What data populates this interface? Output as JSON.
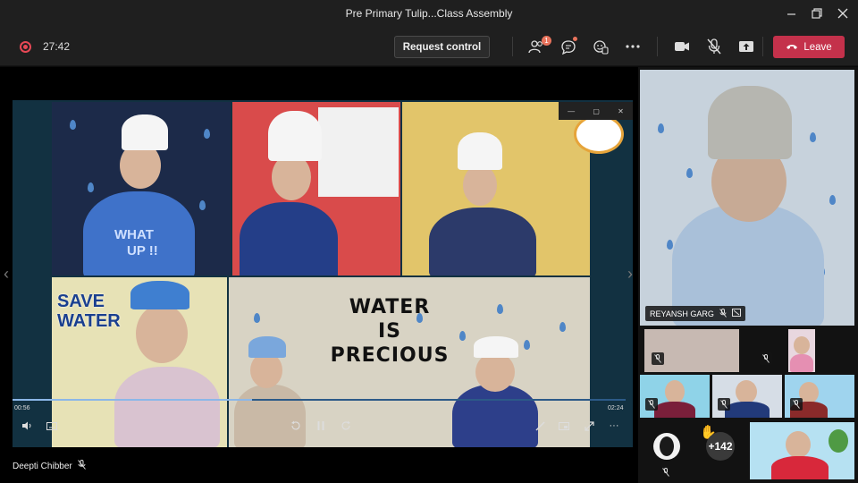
{
  "window": {
    "title": "Pre Primary Tulip...Class Assembly",
    "minimize_icon": "minimize-icon",
    "restore_icon": "restore-icon",
    "close_icon": "close-icon"
  },
  "toolbar": {
    "meeting_timer": "27:42",
    "request_control_label": "Request control",
    "participants_badge": "1",
    "leave_label": "Leave",
    "icons": [
      "record-icon",
      "participants-icon",
      "chat-icon",
      "reactions-icon",
      "more-icon",
      "camera-icon",
      "mic-off-icon",
      "share-icon",
      "phone-icon"
    ]
  },
  "shared_content": {
    "slogan_lines": [
      "WATER",
      "IS",
      "PRECIOUS"
    ],
    "save_water_lines": [
      "SAVE",
      "WATER"
    ],
    "shirt_text_lines": [
      "WHAT",
      "UP !!"
    ],
    "video": {
      "elapsed": "00:56",
      "duration": "02:24",
      "progress_fraction": 0.39
    },
    "presenter_name": "Deepti Chibber"
  },
  "participants": {
    "spotlight_name": "REYANSH GARG",
    "overflow_count": "+142"
  },
  "colors": {
    "leave": "#c4314b",
    "toolbar": "#1f1f1f",
    "badge": "#e8735c"
  }
}
